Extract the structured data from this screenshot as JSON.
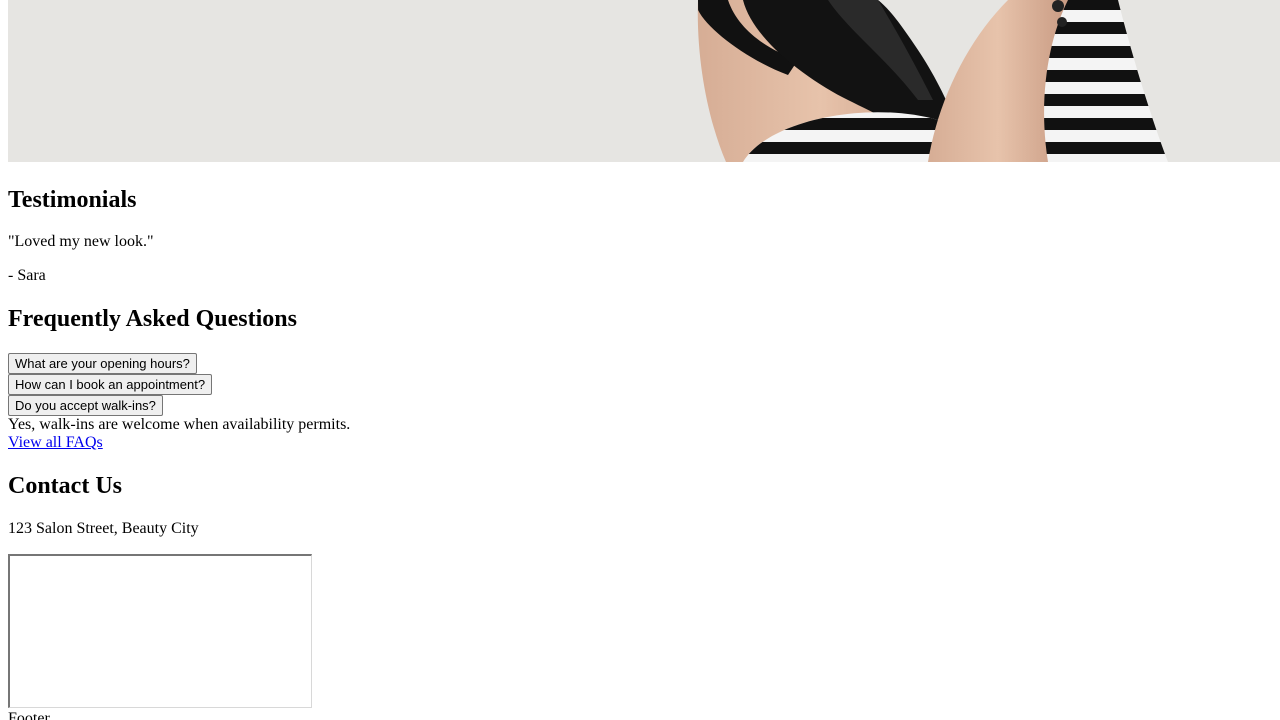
{
  "hero": {
    "image": "salon-hero-photo"
  },
  "testimonials": {
    "heading": "Testimonials",
    "quote": "\"Loved my new look.\"",
    "author": "- Sara"
  },
  "faq": {
    "heading": "Frequently Asked Questions",
    "questions": [
      "What are your opening hours?",
      "How can I book an appointment?",
      "Do you accept walk-ins?"
    ],
    "open_answer": "Yes, walk-ins are welcome when availability permits.",
    "view_all_link": "View all FAQs"
  },
  "contact": {
    "heading": "Contact Us",
    "address": "123 Salon Street, Beauty City"
  },
  "footer": {
    "label": "Footer"
  },
  "colors": {
    "link": "#0000ee",
    "button_bg": "#efefef",
    "button_border": "#767676"
  }
}
